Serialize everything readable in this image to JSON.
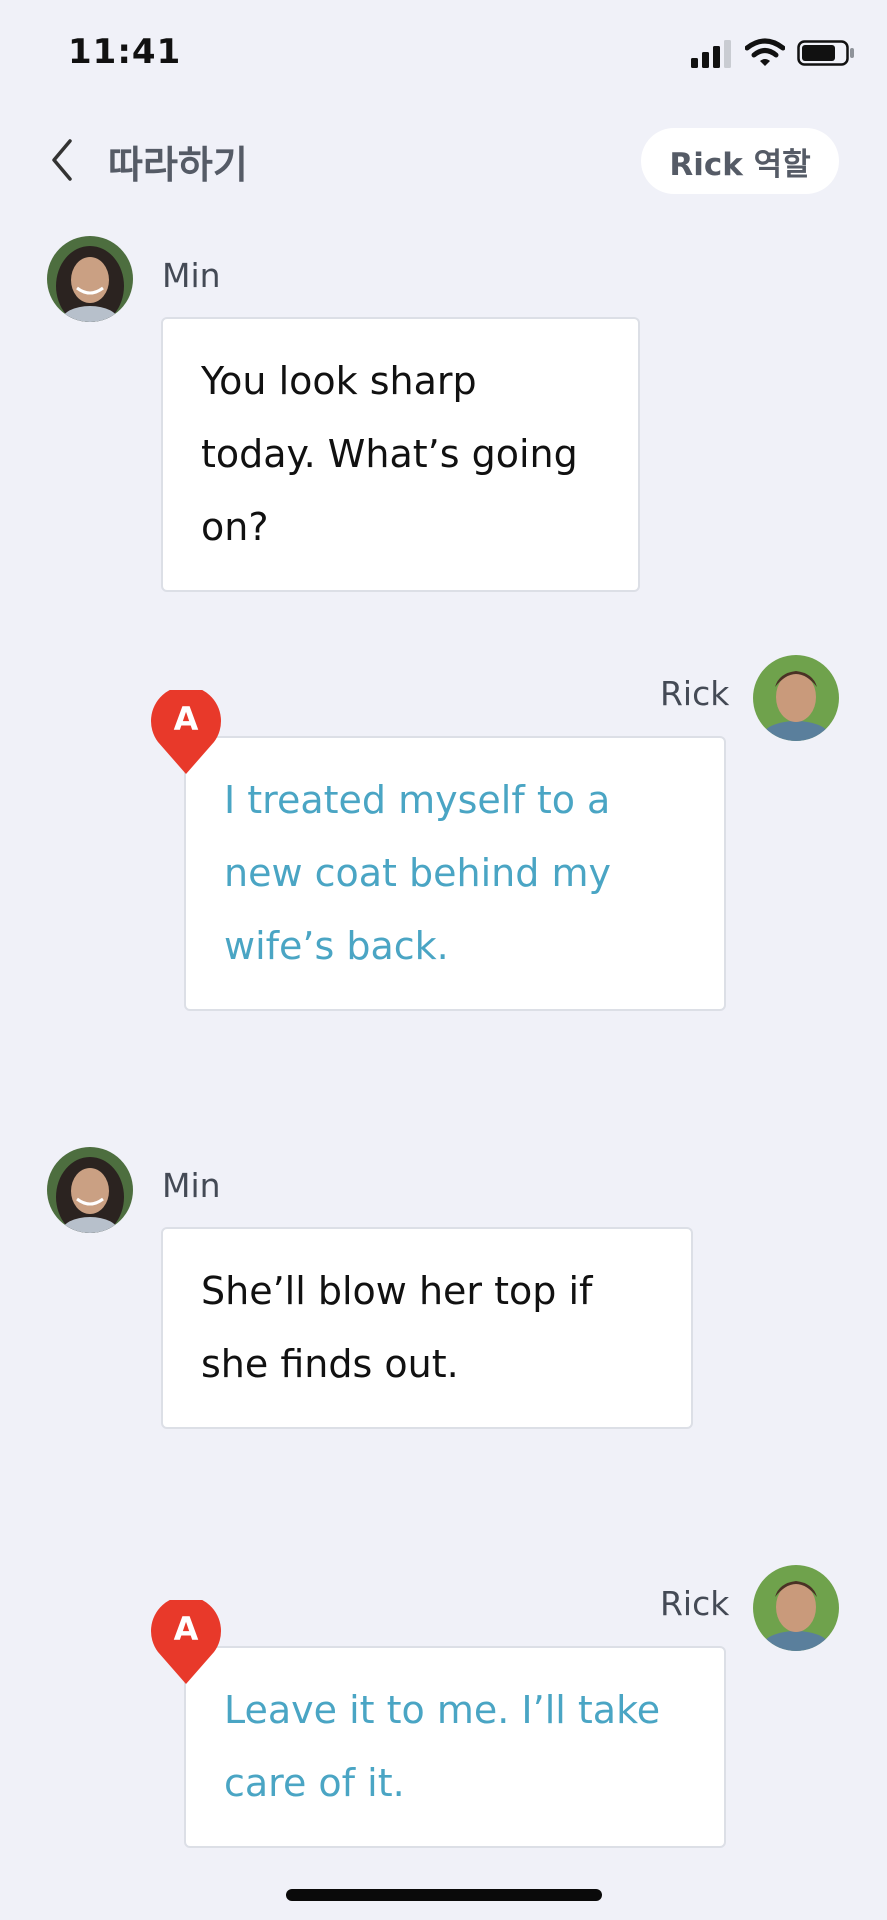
{
  "status_bar": {
    "time": "11:41"
  },
  "header": {
    "title": "따라하기",
    "role_button": "Rick 역할"
  },
  "messages": [
    {
      "speaker": "Min",
      "text": "You look sharp today. What’s going on?"
    },
    {
      "speaker": "Rick",
      "badge": "A",
      "text": "I treated myself to a new coat behind my wife’s back."
    },
    {
      "speaker": "Min",
      "text": "She’ll blow her top if she finds out."
    },
    {
      "speaker": "Rick",
      "badge": "A",
      "text": "Leave it to me. I’ll take care of it."
    }
  ],
  "colors": {
    "background": "#f0f1f8",
    "user_text": "#4aa5c4",
    "badge": "#e8392a"
  }
}
